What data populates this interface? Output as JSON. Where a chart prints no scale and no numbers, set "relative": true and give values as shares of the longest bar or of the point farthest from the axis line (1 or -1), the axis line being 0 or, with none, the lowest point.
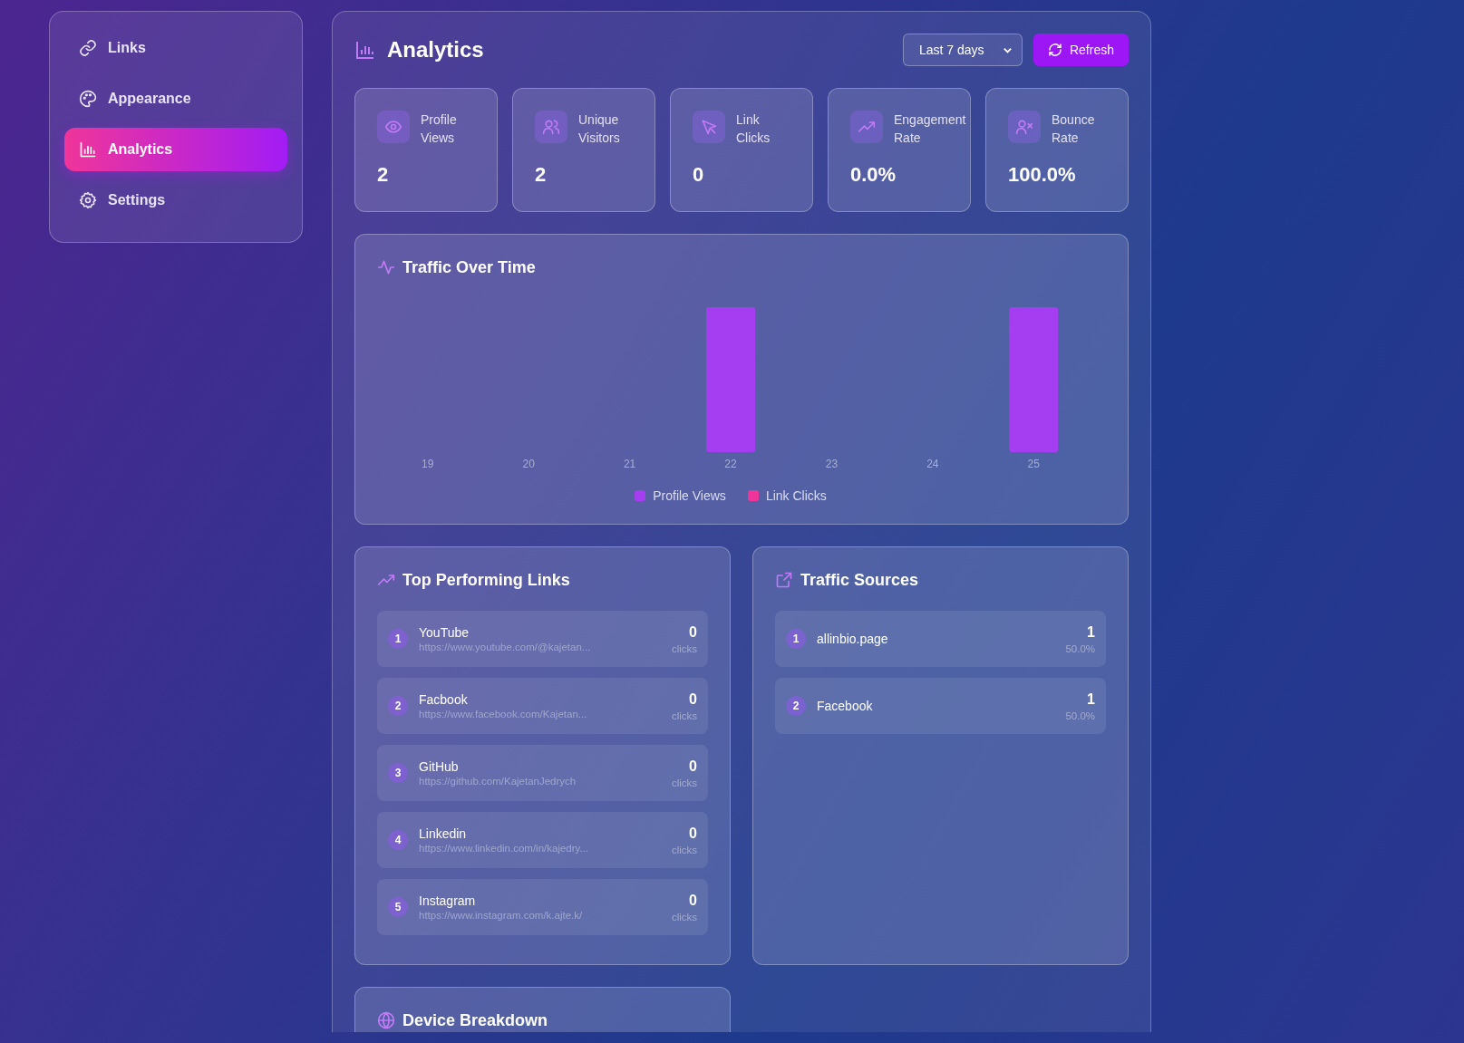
{
  "sidebar": {
    "items": [
      {
        "label": "Links",
        "kind": "link",
        "selected": false
      },
      {
        "label": "Appearance",
        "kind": "palette",
        "selected": false
      },
      {
        "label": "Analytics",
        "kind": "chart",
        "selected": true
      },
      {
        "label": "Settings",
        "kind": "gear",
        "selected": false
      }
    ]
  },
  "header": {
    "title": "Analytics",
    "range": {
      "value": "Last 7 days"
    },
    "refresh": "Refresh"
  },
  "stats": [
    {
      "kind": "eye",
      "label": "Profile Views",
      "value": "2"
    },
    {
      "kind": "users",
      "label": "Unique Visitors",
      "value": "2"
    },
    {
      "kind": "cursor",
      "label": "Link Clicks",
      "value": "0"
    },
    {
      "kind": "trend",
      "label": "Engagement Rate",
      "value": "0.0%"
    },
    {
      "kind": "userx",
      "label": "Bounce Rate",
      "value": "100.0%"
    }
  ],
  "traffic": {
    "title": "Traffic Over Time",
    "chart_data": {
      "type": "bar",
      "relative": true,
      "categories": [
        "19",
        "20",
        "21",
        "22",
        "23",
        "24",
        "25"
      ],
      "series": [
        {
          "name": "Profile Views",
          "color": "#a43ef0",
          "values": [
            0,
            0,
            0,
            1,
            0,
            0,
            1
          ]
        },
        {
          "name": "Link Clicks",
          "color": "#f0359a",
          "values": [
            0,
            0,
            0,
            0,
            0,
            0,
            0
          ]
        }
      ]
    }
  },
  "top_links": {
    "title": "Top Performing Links",
    "items": [
      {
        "rank": "1",
        "name": "YouTube",
        "url": "https://www.youtube.com/@kajetan...",
        "count": "0",
        "unit": "clicks"
      },
      {
        "rank": "2",
        "name": "Facbook",
        "url": "https://www.facebook.com/Kajetan...",
        "count": "0",
        "unit": "clicks"
      },
      {
        "rank": "3",
        "name": "GitHub",
        "url": "https://github.com/KajetanJedrych",
        "count": "0",
        "unit": "clicks"
      },
      {
        "rank": "4",
        "name": "Linkedin",
        "url": "https://www.linkedin.com/in/kajedry...",
        "count": "0",
        "unit": "clicks"
      },
      {
        "rank": "5",
        "name": "Instagram",
        "url": "https://www.instagram.com/k.ajte.k/",
        "count": "0",
        "unit": "clicks"
      }
    ]
  },
  "sources": {
    "title": "Traffic Sources",
    "items": [
      {
        "rank": "1",
        "name": "allinbio.page",
        "count": "1",
        "share": "50.0%"
      },
      {
        "rank": "2",
        "name": "Facebook",
        "count": "1",
        "share": "50.0%"
      }
    ]
  },
  "devices": {
    "title": "Device Breakdown"
  }
}
